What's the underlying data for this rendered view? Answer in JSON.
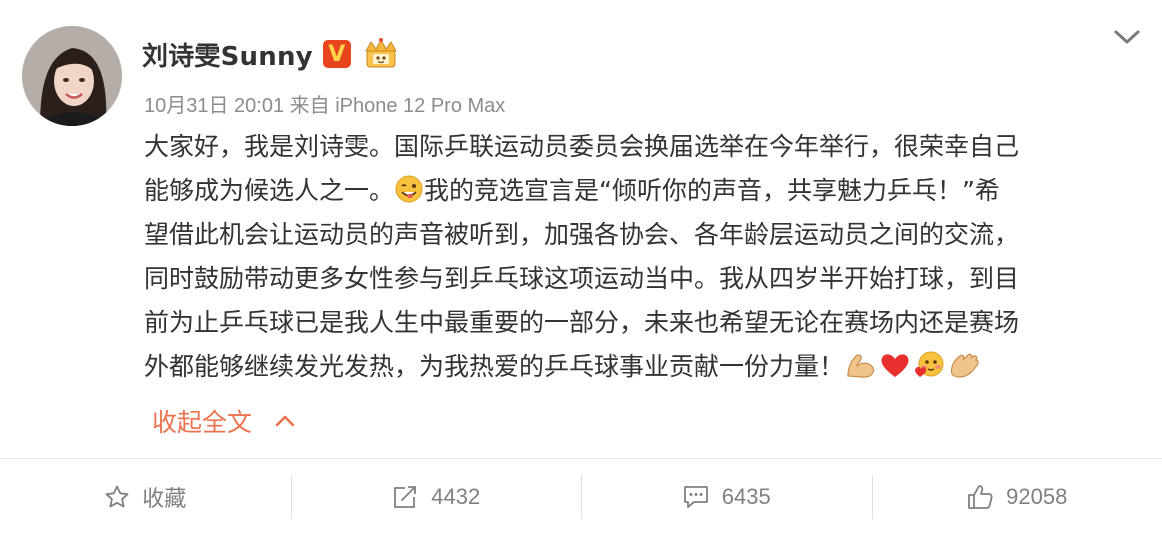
{
  "post": {
    "author": "刘诗雯Sunny",
    "vip_badge": "V",
    "meta": "10月31日 20:01 来自 iPhone 12 Pro Max",
    "lines": [
      [
        "大家好，我是刘诗雯。国际乒联运动员委员会换届选举在今年举行，很荣幸自己"
      ],
      [
        "能够成为候选人之一。",
        "我的竞选宣言是“倾听你的声音，共享魅力乒乓！”希"
      ],
      [
        "望借此机会让运动员的声音被听到，加强各协会、各年龄层运动员之间的交流，"
      ],
      [
        "同时鼓励带动更多女性参与到乒乓球这项运动当中。我从四岁半开始打球，到目"
      ],
      [
        "前为止乒乓球已是我人生中最重要的一部分，未来也希望无论在赛场内还是赛场"
      ],
      [
        "外都能够继续发光发热，为我热爱的乒乓球事业贡献一份力量！"
      ]
    ],
    "collapse_label": "收起全文"
  },
  "actions": {
    "favorite": "收藏",
    "repost": "4432",
    "comment": "6435",
    "like": "92058"
  },
  "colors": {
    "link_orange": "#eb7350",
    "vip_red": "#e8451e",
    "text": "#333333",
    "muted": "#8c8c8c"
  },
  "icons": [
    "chevron-down-icon",
    "wink-emoji-icon",
    "muscle-emoji-icon",
    "heart-emoji-icon",
    "blush-emoji-icon",
    "clap-emoji-icon",
    "chevron-up-icon",
    "star-icon",
    "repost-icon",
    "comment-icon",
    "thumbs-up-icon"
  ]
}
